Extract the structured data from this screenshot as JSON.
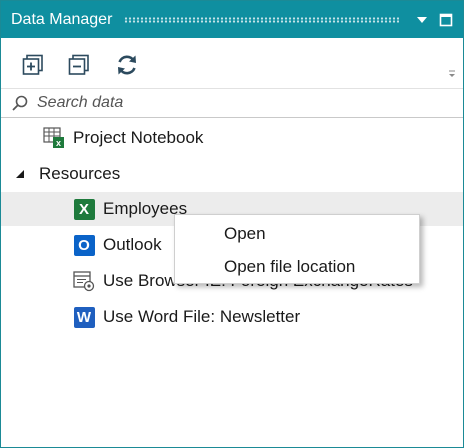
{
  "window": {
    "title": "Data Manager",
    "dropdown_icon": "triangle-down-icon",
    "maximize_icon": "window-square-icon"
  },
  "toolbar": {
    "buttons": [
      {
        "name": "expand-all-button",
        "icon": "plus-box-icon"
      },
      {
        "name": "collapse-all-button",
        "icon": "minus-box-icon"
      },
      {
        "name": "refresh-button",
        "icon": "refresh-icon"
      }
    ]
  },
  "search": {
    "placeholder": "Search data",
    "value": ""
  },
  "tree": {
    "project_notebook": "Project Notebook",
    "resources": "Resources",
    "items": [
      {
        "label": "Employees",
        "icon": "excel-icon",
        "badge": "X"
      },
      {
        "label": "Outlook",
        "icon": "outlook-icon",
        "badge": "O"
      },
      {
        "label": "Use Browser IE: Foreign ExchangeRates",
        "icon": "browser-gear-icon"
      },
      {
        "label": "Use Word File: Newsletter",
        "icon": "word-icon",
        "badge": "W"
      }
    ]
  },
  "context_menu": {
    "items": [
      "Open",
      "Open file location"
    ]
  },
  "colors": {
    "titlebar": "#0f8fa0",
    "excel": "#1e7a3c",
    "outlook": "#0a63c8",
    "word": "#1f5fbf",
    "icon": "#2c4a5e"
  }
}
